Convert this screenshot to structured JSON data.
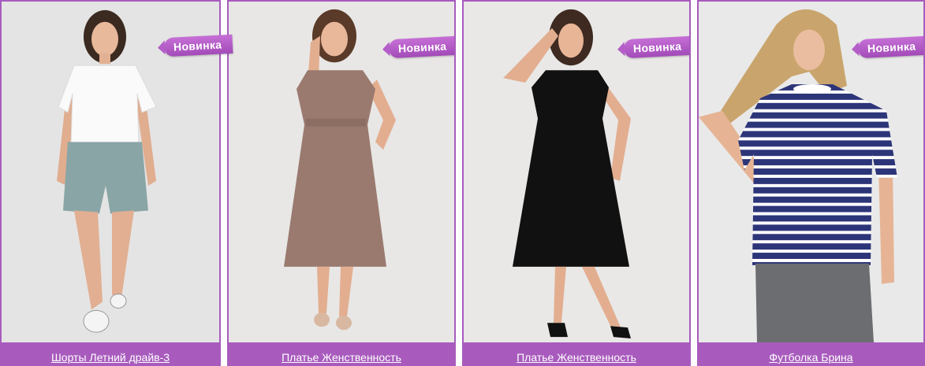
{
  "brand_color": "#a85bbd",
  "products": [
    {
      "title": "Шорты Летний драйв-3",
      "badge": ""
    },
    {
      "title": "Платье Женственность",
      "badge": "Новинка"
    },
    {
      "title": "Платье Женственность",
      "badge": "Новинка"
    },
    {
      "title": "Футболка Брина",
      "badge": "Новинка"
    }
  ],
  "badge_first": "Новинка"
}
